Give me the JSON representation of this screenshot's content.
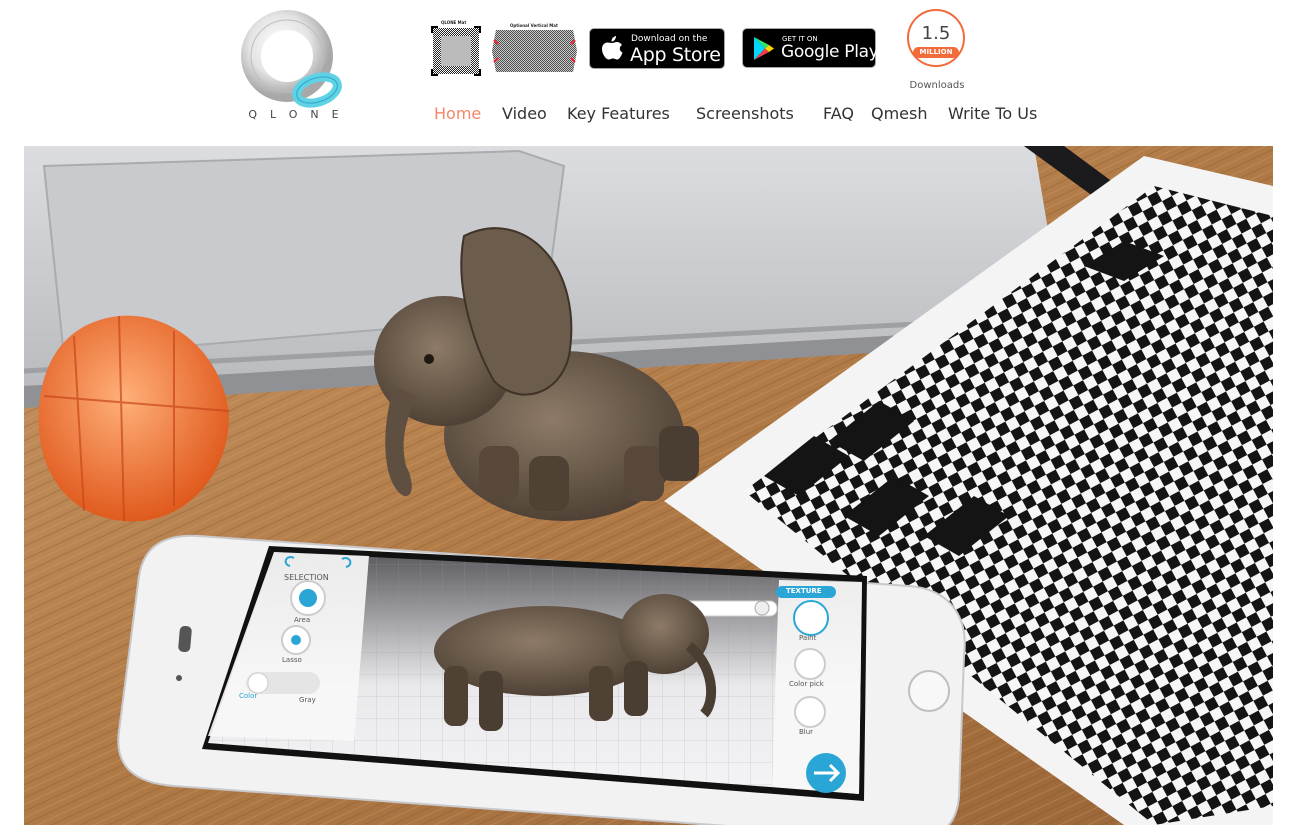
{
  "logo": {
    "text": "QLONE"
  },
  "mats": {
    "qlone_mat_label": "QLONE Mat",
    "vertical_mat_label": "Optional Vertical Mat"
  },
  "app_store": {
    "small": "Download on the",
    "big": "App Store"
  },
  "google_play": {
    "small": "GET IT ON",
    "big": "Google Play"
  },
  "downloads": {
    "number": "1.5",
    "unit": "MILLION",
    "label": "Downloads"
  },
  "nav": {
    "items": [
      {
        "label": "Home",
        "active": true
      },
      {
        "label": "Video"
      },
      {
        "label": "Key Features"
      },
      {
        "label": "Screenshots"
      },
      {
        "label": "FAQ"
      },
      {
        "label": "Qmesh"
      },
      {
        "label": "Write To Us"
      }
    ]
  },
  "phone_ui": {
    "selection_label": "SELECTION",
    "area_label": "Area",
    "lasso_label": "Lasso",
    "toggle_left": "Color",
    "toggle_right": "Gray",
    "texture_label": "TEXTURE",
    "paint_label": "Paint",
    "color_pick_label": "Color pick",
    "blur_label": "Blur"
  },
  "colors": {
    "accent": "#f26b3a",
    "nav_active": "#f4866a",
    "texture_blue": "#2aa6d6",
    "logo_ring": "#4cc6db"
  }
}
